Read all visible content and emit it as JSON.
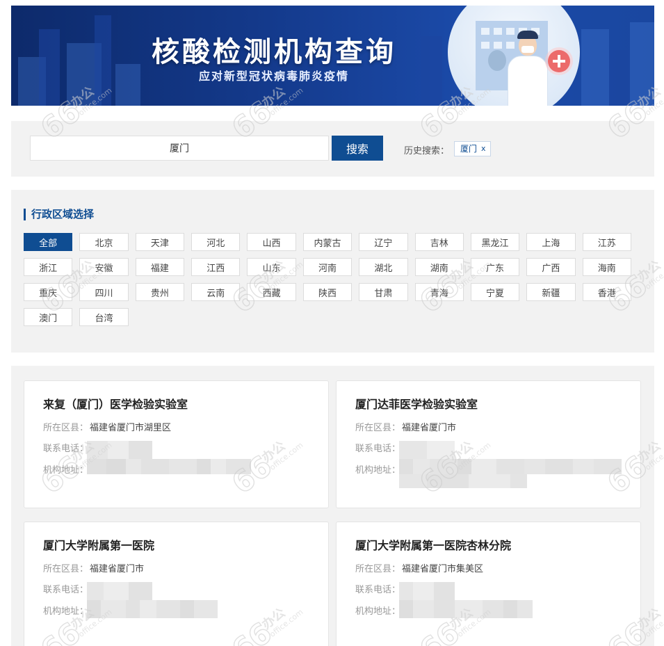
{
  "banner": {
    "title": "核酸检测机构查询",
    "subtitle": "应对新型冠状病毒肺炎疫情"
  },
  "search": {
    "value": "厦门",
    "button_label": "搜索",
    "history_label": "历史搜索：",
    "history_tags": [
      {
        "label": "厦门",
        "remove": "x"
      }
    ]
  },
  "regions": {
    "title": "行政区域选择",
    "items": [
      "全部",
      "北京",
      "天津",
      "河北",
      "山西",
      "内蒙古",
      "辽宁",
      "吉林",
      "黑龙江",
      "上海",
      "江苏",
      "浙江",
      "安徽",
      "福建",
      "江西",
      "山东",
      "河南",
      "湖北",
      "湖南",
      "广东",
      "广西",
      "海南",
      "重庆",
      "四川",
      "贵州",
      "云南",
      "西藏",
      "陕西",
      "甘肃",
      "青海",
      "宁夏",
      "新疆",
      "香港",
      "澳门",
      "台湾"
    ],
    "active_index": 0
  },
  "field_labels": {
    "district": "所在区县：",
    "phone": "联系电话：",
    "address": "机构地址："
  },
  "results": [
    {
      "name": "来复（厦门）医学检验实验室",
      "district": "福建省厦门市湖里区"
    },
    {
      "name": "厦门达菲医学检验实验室",
      "district": "福建省厦门市"
    },
    {
      "name": "厦门大学附属第一医院",
      "district": "福建省厦门市"
    },
    {
      "name": "厦门大学附属第一医院杏林分院",
      "district": "福建省厦门市集美区"
    }
  ],
  "watermark": {
    "mark": "66",
    "brand": "办公",
    "site": "office.com"
  }
}
